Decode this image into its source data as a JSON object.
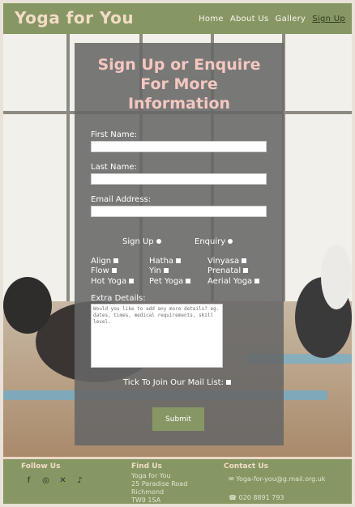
{
  "header": {
    "brand": "Yoga for You",
    "nav": [
      "Home",
      "About Us",
      "Gallery",
      "Sign Up"
    ]
  },
  "form": {
    "title_lines": [
      "Sign Up or Enquire",
      "For More",
      "Information"
    ],
    "first_name_label": "First Name:",
    "last_name_label": "Last Name:",
    "email_label": "Email Address:",
    "radio_signup": "Sign Up",
    "radio_enquiry": "Enquiry",
    "classes": [
      "Align",
      "Hatha",
      "Vinyasa",
      "Flow",
      "Yin",
      "Prenatal",
      "Hot Yoga",
      "Pet Yoga",
      "Aerial Yoga"
    ],
    "extra_label": "Extra Details:",
    "extra_placeholder": "Would you like to add any more details? eg. dates, times, medical requirements, skill level.",
    "mail_list_label": "Tick To Join Our Mail List:",
    "submit_label": "Submit"
  },
  "footer": {
    "follow_heading": "Follow Us",
    "social_icons": [
      "facebook-icon",
      "instagram-icon",
      "x-icon",
      "tiktok-icon"
    ],
    "find_heading": "Find Us",
    "address": [
      "Yoga for You",
      "25 Paradise Road",
      "Richmond",
      "TW9 1SA"
    ],
    "contact_heading": "Contact Us",
    "email": "Yoga-for-you@g.mail.org.uk",
    "phone": "020 8891 793"
  },
  "colors": {
    "accent": "#869764",
    "title": "#f4c7c0",
    "brand": "#f3dcc6"
  }
}
